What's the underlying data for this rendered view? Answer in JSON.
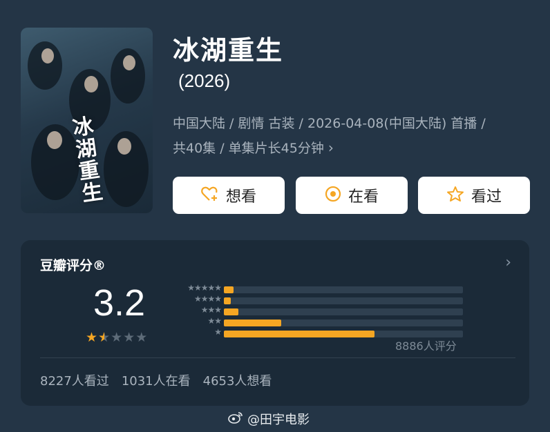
{
  "movie": {
    "title": "冰湖重生",
    "year": "(2026)",
    "meta_line1": "中国大陆 / 剧情 古装 / 2026-04-08(中国大陆) 首播 /",
    "meta_line2": "共40集 / 单集片长45分钟",
    "poster_title": "冰湖重生"
  },
  "buttons": {
    "want": {
      "label": "想看",
      "icon": "heart-plus-icon"
    },
    "watching": {
      "label": "在看",
      "icon": "target-icon"
    },
    "watched": {
      "label": "看过",
      "icon": "star-outline-icon"
    }
  },
  "rating": {
    "title": "豆瓣评分®",
    "score": "3.2",
    "stars_filled": 1.5,
    "stars_total": 5,
    "distribution": [
      {
        "stars": 5,
        "fraction": 0.04
      },
      {
        "stars": 4,
        "fraction": 0.03
      },
      {
        "stars": 3,
        "fraction": 0.06
      },
      {
        "stars": 2,
        "fraction": 0.24
      },
      {
        "stars": 1,
        "fraction": 0.63
      }
    ],
    "raters": "8886人评分",
    "stats": [
      "8227人看过",
      "1031人在看",
      "4653人想看"
    ]
  },
  "watermark": "@田宇电影",
  "colors": {
    "accent": "#f5a623",
    "background": "#243546",
    "card": "#1b2a38"
  }
}
